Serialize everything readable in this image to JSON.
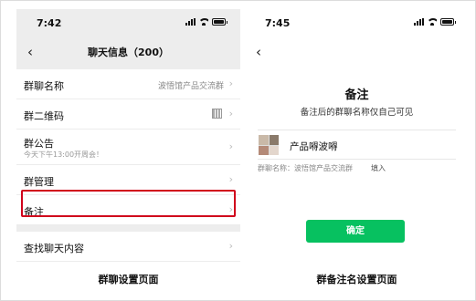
{
  "left_phone": {
    "status": {
      "time": "7:42"
    },
    "nav": {
      "back": "‹",
      "title": "聊天信息（200）"
    },
    "rows": {
      "group_name": {
        "label": "群聊名称",
        "value": "波悟馆产品交流群"
      },
      "qr_code": {
        "label": "群二维码"
      },
      "announcement": {
        "label": "群公告",
        "sub": "今天下午13:00开周会！"
      },
      "manage": {
        "label": "群管理"
      },
      "remark": {
        "label": "备注"
      },
      "search_history": {
        "label": "查找聊天内容"
      }
    },
    "caption": "群聊设置页面"
  },
  "right_phone": {
    "status": {
      "time": "7:45"
    },
    "nav": {
      "back": "‹"
    },
    "title": "备注",
    "description": "备注后的群聊名称仅自己可见",
    "remark_name": "产品嘚波嘚",
    "original_name": "群聊名称：波悟馆产品交流群",
    "fill_link": "填入",
    "confirm_label": "确定",
    "caption": "群备注名设置页面"
  },
  "colors": {
    "accent_green": "#07c160",
    "highlight_red": "#d0021b"
  },
  "icons": [
    "back-arrow-icon",
    "chevron-right-icon",
    "qr-code-icon",
    "signal-icon",
    "wifi-icon",
    "battery-icon"
  ]
}
